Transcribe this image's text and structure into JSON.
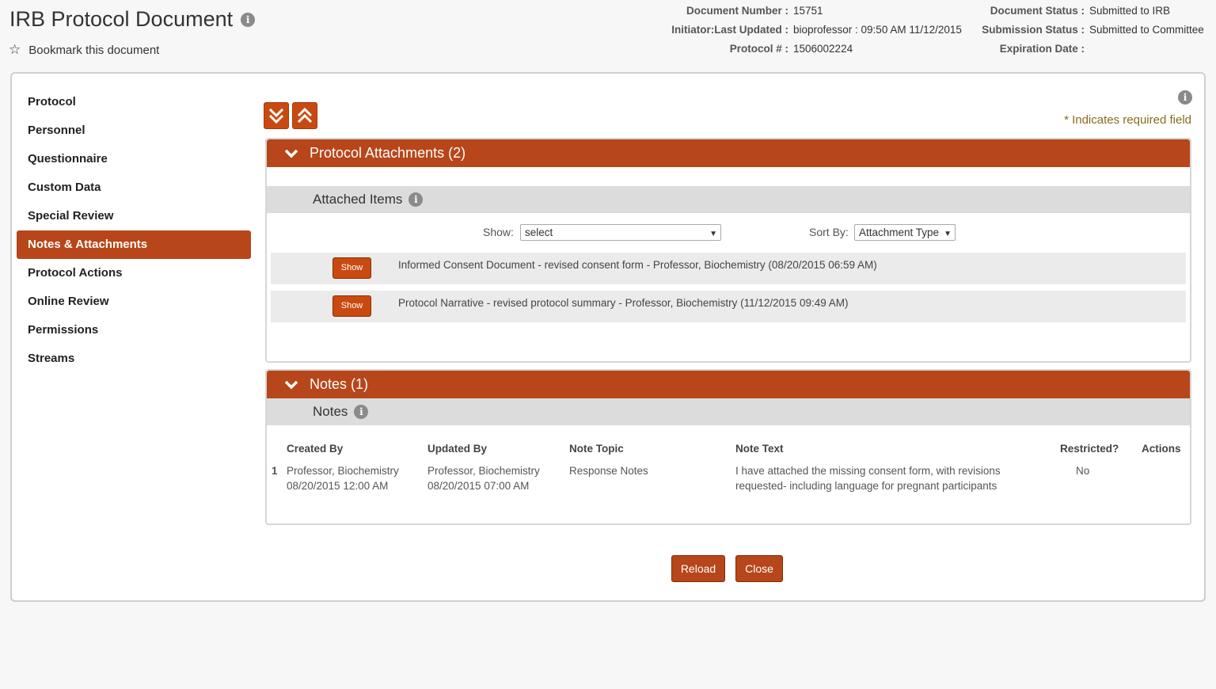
{
  "header": {
    "title": "IRB Protocol Document",
    "bookmark_label": "Bookmark this document",
    "meta_left": [
      {
        "label": "Document Number :",
        "value": "15751"
      },
      {
        "label": "Initiator:Last Updated :",
        "value": "bioprofessor : 09:50 AM 11/12/2015"
      },
      {
        "label": "Protocol # :",
        "value": "1506002224"
      }
    ],
    "meta_right": [
      {
        "label": "Document Status :",
        "value": "Submitted to IRB"
      },
      {
        "label": "Submission Status :",
        "value": "Submitted to Committee"
      },
      {
        "label": "Expiration Date :",
        "value": ""
      }
    ]
  },
  "nav": {
    "items": [
      "Protocol",
      "Personnel",
      "Questionnaire",
      "Custom Data",
      "Special Review",
      "Notes & Attachments",
      "Protocol Actions",
      "Online Review",
      "Permissions",
      "Streams"
    ],
    "active": "Notes & Attachments"
  },
  "required_note": "* Indicates required field",
  "attachments": {
    "title": "Protocol Attachments (2)",
    "subtitle": "Attached Items",
    "show_label": "Show:",
    "show_value": "select",
    "sort_label": "Sort By:",
    "sort_value": "Attachment Type",
    "items": [
      {
        "button": "Show",
        "text": "Informed Consent Document - revised consent form - Professor, Biochemistry (08/20/2015 06:59 AM)"
      },
      {
        "button": "Show",
        "text": "Protocol Narrative - revised protocol summary - Professor, Biochemistry (11/12/2015 09:49 AM)"
      }
    ]
  },
  "notes": {
    "title": "Notes (1)",
    "subtitle": "Notes",
    "columns": [
      "Created By",
      "Updated By",
      "Note Topic",
      "Note Text",
      "Restricted?",
      "Actions"
    ],
    "rows": [
      {
        "index": "1",
        "created_by": "Professor, Biochemistry",
        "created_at": "08/20/2015 12:00 AM",
        "updated_by": "Professor, Biochemistry",
        "updated_at": "08/20/2015 07:00 AM",
        "topic": "Response Notes",
        "text_line1": "I have attached the missing consent form, with revisions",
        "text_line2": "requested- including language for pregnant participants",
        "restricted": "No"
      }
    ]
  },
  "buttons": {
    "reload": "Reload",
    "close": "Close"
  },
  "colors": {
    "accent": "#b7461a",
    "required_text": "#8a6a1d"
  }
}
